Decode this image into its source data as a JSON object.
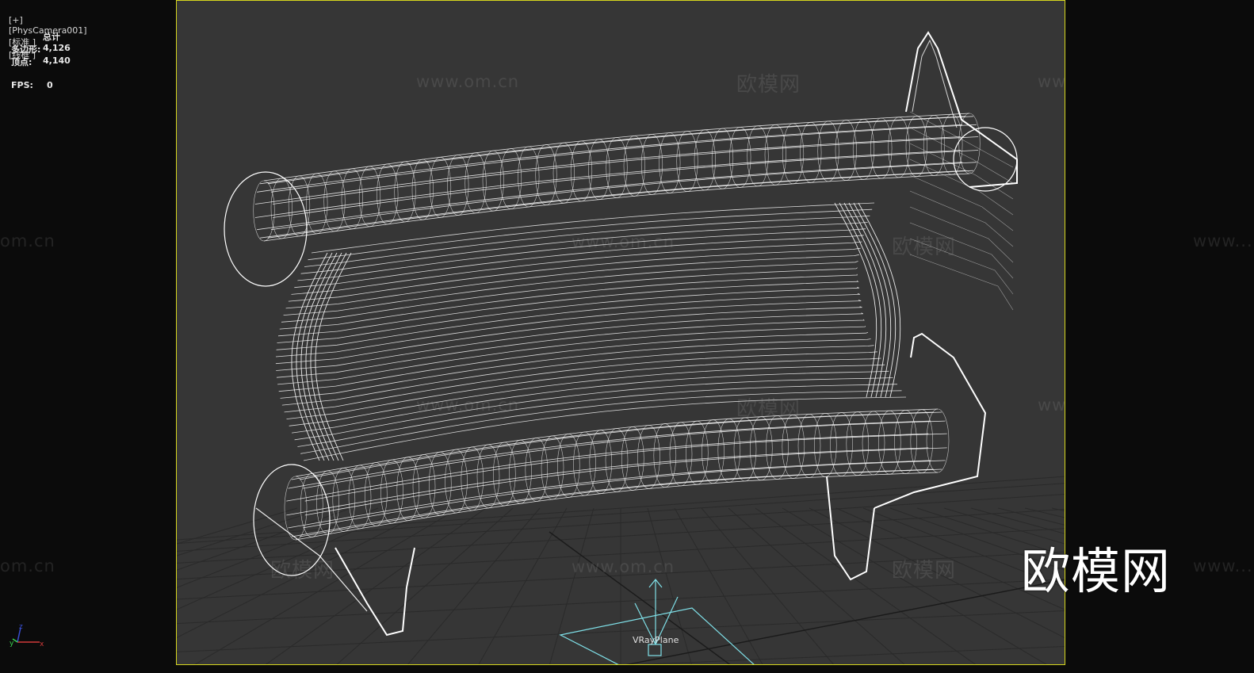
{
  "viewport": {
    "label_plus": "[+]",
    "camera": "[PhysCamera001]",
    "shading": "[标准 ]",
    "display": "[线框 ]"
  },
  "stats": {
    "header": "总计",
    "polygons_label": "多边形:",
    "polygons_value": "4,126",
    "vertices_label": "顶点:",
    "vertices_value": "4,140",
    "fps_label": "FPS:",
    "fps_value": "0"
  },
  "scene": {
    "helper_label": "VRayPlane",
    "wire_color": "#ffffff",
    "helper_color": "#7fe0e8",
    "frame_color": "#d6d61e"
  },
  "watermarks": {
    "brand_cn": "欧模网",
    "site": "www.om.cn",
    "site_partial": "om.cn",
    "site_prefix": "www..."
  },
  "brand_logo": "欧模网",
  "axis_gizmo": {
    "x": "x",
    "y": "y",
    "z": "z"
  }
}
